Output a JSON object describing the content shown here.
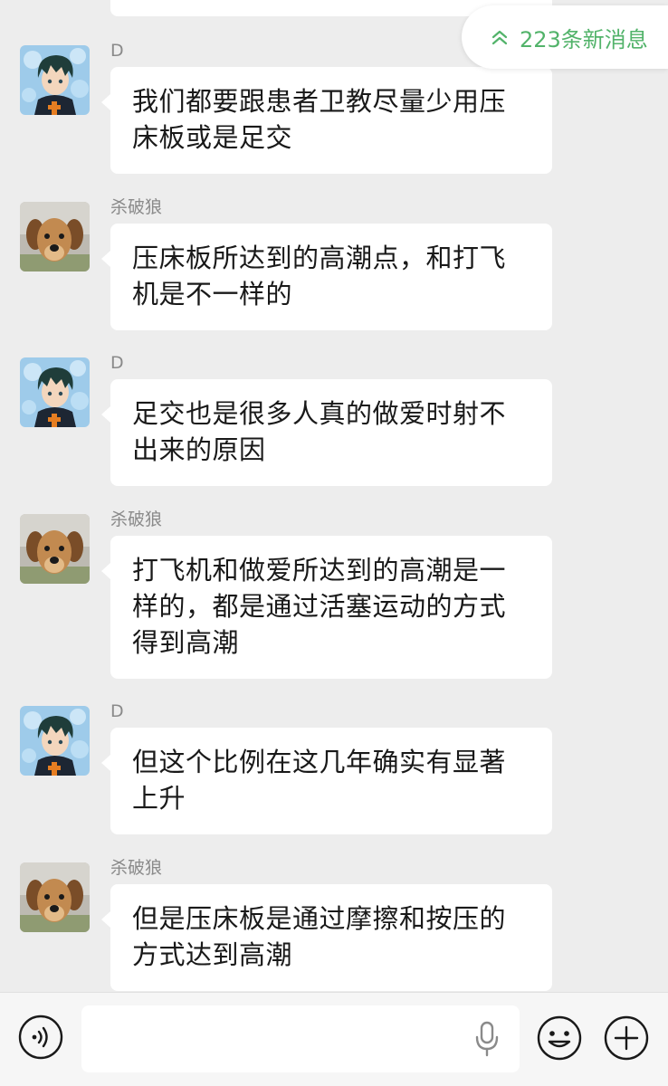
{
  "new_messages": {
    "label": "223条新消息"
  },
  "messages": [
    {
      "sender": "D",
      "avatar": "anime-boy-avatar",
      "text": "我们都要跟患者卫教尽量少用压床板或是足交"
    },
    {
      "sender": "杀破狼",
      "avatar": "dog-avatar",
      "text": "压床板所达到的高潮点，和打飞机是不一样的"
    },
    {
      "sender": "D",
      "avatar": "anime-boy-avatar",
      "text": "足交也是很多人真的做爱时射不出来的原因"
    },
    {
      "sender": "杀破狼",
      "avatar": "dog-avatar",
      "text": "打飞机和做爱所达到的高潮是一样的，都是通过活塞运动的方式得到高潮"
    },
    {
      "sender": "D",
      "avatar": "anime-boy-avatar",
      "text": "但这个比例在这几年确实有显著上升"
    },
    {
      "sender": "杀破狼",
      "avatar": "dog-avatar",
      "text": "但是压床板是通过摩擦和按压的方式达到高潮"
    }
  ],
  "input_bar": {
    "placeholder": "",
    "value": "",
    "icons": [
      "voice-icon",
      "mic-icon",
      "emoji-icon",
      "plus-icon"
    ]
  },
  "colors": {
    "background": "#ededed",
    "bubble": "#ffffff",
    "accent_green": "#52b36a"
  }
}
